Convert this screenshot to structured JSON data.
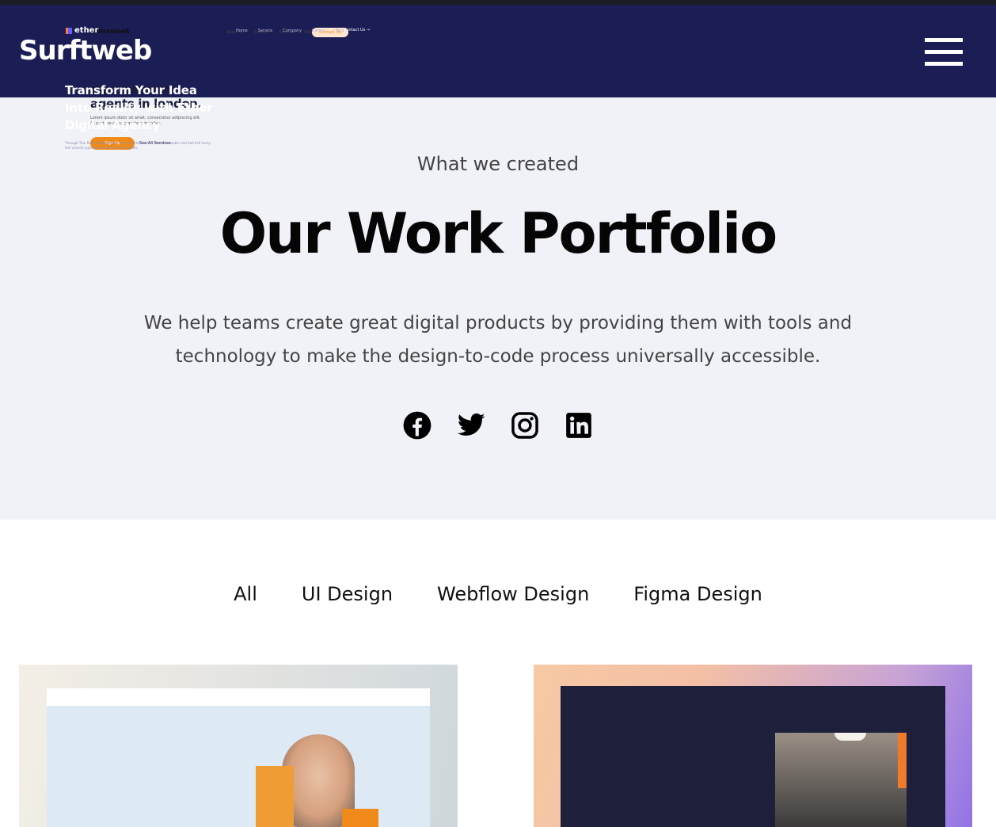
{
  "header": {
    "logo": "Surftweb",
    "menu_icon": "hamburger-menu-icon",
    "background": "#1b1d55"
  },
  "hero": {
    "eyebrow": "What we created",
    "title": "Our Work Portfolio",
    "description": "We help teams create great digital products by providing them with tools and technology to make the design-to-code process universally accessible.",
    "background": "#f0f2f8",
    "socials": [
      {
        "name": "facebook-icon"
      },
      {
        "name": "twitter-icon"
      },
      {
        "name": "instagram-icon"
      },
      {
        "name": "linkedin-icon"
      }
    ]
  },
  "filters": {
    "items": [
      "All",
      "UI Design",
      "Webflow Design",
      "Figma Design"
    ]
  },
  "portfolio": {
    "cards": [
      {
        "logo": "{finsweet",
        "nav_links": [
          "About Us",
          "Careers",
          "Services",
          "Blog"
        ],
        "cta": "Contact Us",
        "heading": "We're estate agents in london.",
        "body": "Lorem ipsum dolor sit amet, consectetur adipiscing elit. Aliquet leo odio, gravida quis tellus.",
        "primary_button": "Sign Up",
        "secondary_link": "See All Services",
        "accent": "#f08a1a"
      },
      {
        "logo": "ether",
        "nav_links": [
          "Home",
          "Service",
          "Company",
          "Career",
          "Blog"
        ],
        "cta": "Contact Us →",
        "heading": "Transform Your Idea Into Reality with Ether Digital Agency",
        "body": "Through True Rich Attended does no end of the mother since favourable real had half every him concern packages enquire we up ecstatic.",
        "accent": "#5d5cff"
      }
    ]
  }
}
